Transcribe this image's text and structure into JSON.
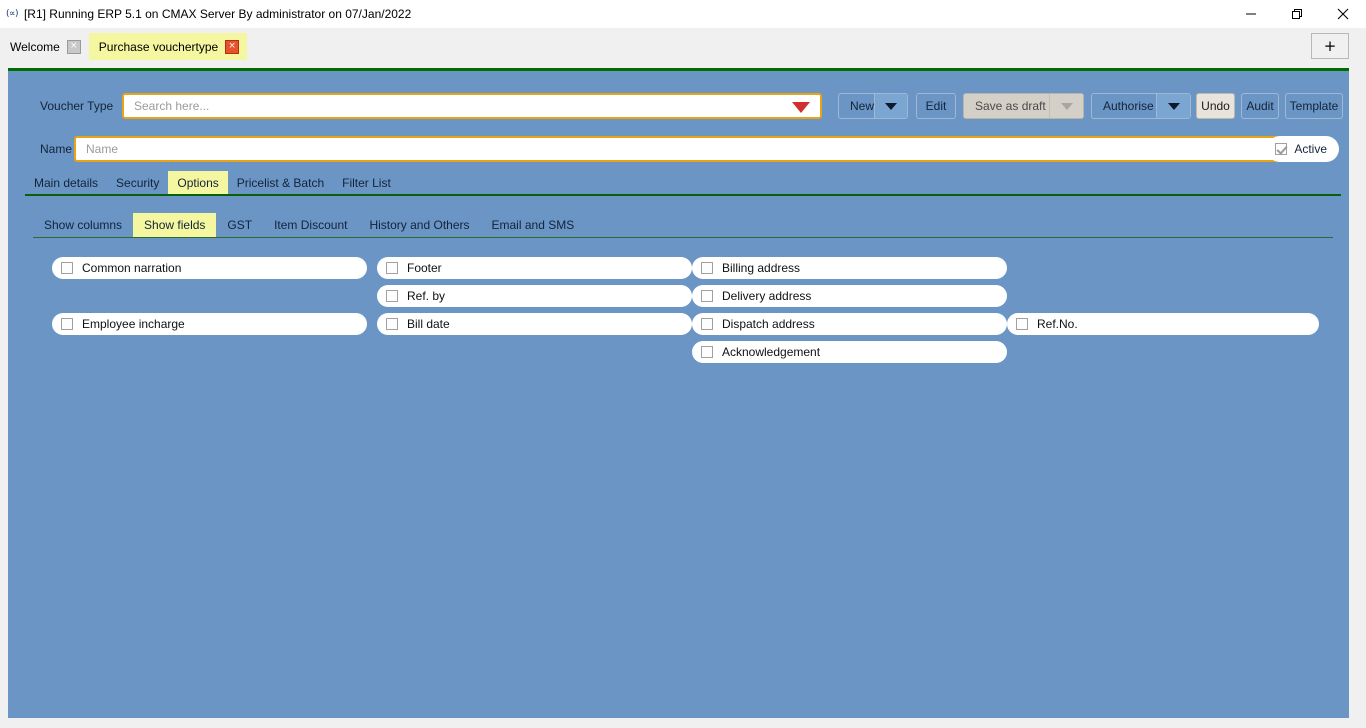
{
  "window": {
    "title": "[R1] Running ERP 5.1 on CMAX Server By administrator on 07/Jan/2022",
    "app_glyph": "(∝)",
    "controls": {
      "minimize": "minimize-icon",
      "maximize": "maximize-icon",
      "close": "close-icon"
    }
  },
  "tabstrip": {
    "tabs": [
      {
        "label": "Welcome",
        "active": false,
        "close": "×"
      },
      {
        "label": "Purchase vouchertype",
        "active": true,
        "close": "×"
      }
    ],
    "new_tab": "+"
  },
  "form": {
    "voucher_type_label": "Voucher Type",
    "search_placeholder": "Search here...",
    "search_value": "",
    "name_label": "Name",
    "name_placeholder": "Name",
    "name_value": "",
    "active_label": "Active",
    "active_checked": true
  },
  "toolbar": {
    "new_label": "New",
    "edit_label": "Edit",
    "save_as_draft_label": "Save as draft",
    "authorise_label": "Authorise",
    "undo_label": "Undo",
    "audit_label": "Audit",
    "template_label": "Template"
  },
  "main_tabs": [
    {
      "label": "Main details",
      "active": false
    },
    {
      "label": "Security",
      "active": false
    },
    {
      "label": "Options",
      "active": true
    },
    {
      "label": "Pricelist & Batch",
      "active": false
    },
    {
      "label": "Filter List",
      "active": false
    }
  ],
  "sub_tabs": [
    {
      "label": "Show columns",
      "active": false
    },
    {
      "label": "Show fields",
      "active": true
    },
    {
      "label": "GST",
      "active": false
    },
    {
      "label": "Item Discount",
      "active": false
    },
    {
      "label": "History and Others",
      "active": false
    },
    {
      "label": "Email and SMS",
      "active": false
    }
  ],
  "fields": {
    "col1": [
      {
        "label": "Common narration",
        "checked": false
      },
      {
        "label": "",
        "blank": true
      },
      {
        "label": "Employee incharge",
        "checked": false
      }
    ],
    "col2": [
      {
        "label": "Footer",
        "checked": false
      },
      {
        "label": "Ref. by",
        "checked": false
      },
      {
        "label": "Bill date",
        "checked": false
      }
    ],
    "col3": [
      {
        "label": "Billing address",
        "checked": false
      },
      {
        "label": "Delivery address",
        "checked": false
      },
      {
        "label": "Dispatch address",
        "checked": false
      },
      {
        "label": "Acknowledgement",
        "checked": false
      }
    ],
    "col4": [
      {
        "label": "",
        "blank": true
      },
      {
        "label": "",
        "blank": true
      },
      {
        "label": "Ref.No.",
        "checked": false
      }
    ]
  },
  "colors": {
    "content_bg": "#6a95c4",
    "accent_green": "#006c00",
    "active_tab": "#f4f7a0",
    "field_focus": "#e8a317",
    "dropdown_red": "#d32f2f"
  }
}
